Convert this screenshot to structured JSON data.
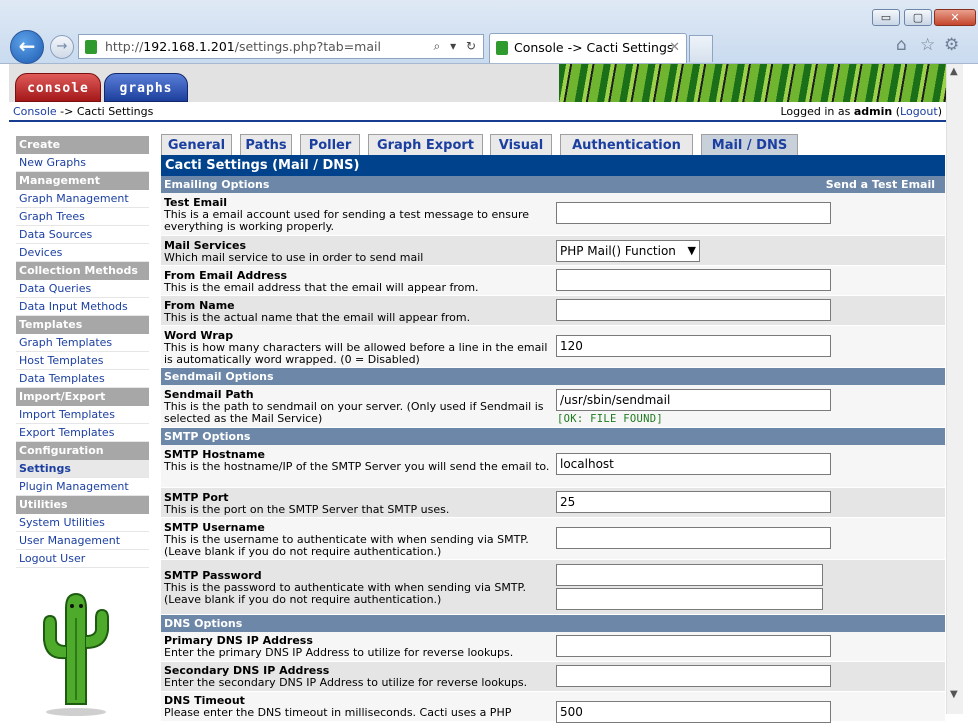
{
  "browser": {
    "url_prefix": "http://",
    "url_host": "192.168.1.201",
    "url_path": "/settings.php?tab=mail",
    "tab_title": "Console -> Cacti Settings",
    "back_glyph": "←",
    "forward_glyph": "→",
    "search_glyph": "⌕ ▾",
    "refresh_glyph": "↻",
    "tab_close_glyph": "✕",
    "min_glyph": "▭",
    "max_glyph": "▢",
    "close_glyph": "✕",
    "icons": [
      "home-icon",
      "favorites-star-icon",
      "tools-gear-icon"
    ]
  },
  "header": {
    "tab_console": "console",
    "tab_graphs": "graphs"
  },
  "breadcrumb": {
    "link": "Console",
    "sep": " -> ",
    "current": "Cacti Settings",
    "logged_in_prefix": "Logged in as ",
    "user": "admin",
    "logout_open": " (",
    "logout_label": "Logout",
    "logout_close": ")"
  },
  "sidebar": {
    "groups": [
      {
        "title": "Create",
        "items": [
          "New Graphs"
        ]
      },
      {
        "title": "Management",
        "items": [
          "Graph Management",
          "Graph Trees",
          "Data Sources",
          "Devices"
        ]
      },
      {
        "title": "Collection Methods",
        "items": [
          "Data Queries",
          "Data Input Methods"
        ]
      },
      {
        "title": "Templates",
        "items": [
          "Graph Templates",
          "Host Templates",
          "Data Templates"
        ]
      },
      {
        "title": "Import/Export",
        "items": [
          "Import Templates",
          "Export Templates"
        ]
      },
      {
        "title": "Configuration",
        "items": [
          "Settings",
          "Plugin Management"
        ]
      },
      {
        "title": "Utilities",
        "items": [
          "System Utilities",
          "User Management",
          "Logout User"
        ]
      }
    ],
    "active_item": "Settings"
  },
  "tabs": [
    "General",
    "Paths",
    "Poller",
    "Graph Export",
    "Visual",
    "Authentication",
    "Mail / DNS"
  ],
  "active_tab": "Mail / DNS",
  "settings": {
    "title": "Cacti Settings (Mail / DNS)",
    "emailing_header": "Emailing Options",
    "send_test": "Send a Test Email",
    "test_email_label": "Test Email",
    "test_email_desc": "This is a email account used for sending a test message to ensure everything is working properly.",
    "test_email_value": "",
    "mail_services_label": "Mail Services",
    "mail_services_desc": "Which mail service to use in order to send mail",
    "mail_services_value": "PHP Mail() Function",
    "from_email_label": "From Email Address",
    "from_email_desc": "This is the email address that the email will appear from.",
    "from_email_value": "",
    "from_name_label": "From Name",
    "from_name_desc": "This is the actual name that the email will appear from.",
    "from_name_value": "",
    "word_wrap_label": "Word Wrap",
    "word_wrap_desc": "This is how many characters will be allowed before a line in the email is automatically word wrapped. (0 = Disabled)",
    "word_wrap_value": "120",
    "sendmail_header": "Sendmail Options",
    "sendmail_path_label": "Sendmail Path",
    "sendmail_path_desc": "This is the path to sendmail on your server. (Only used if Sendmail is selected as the Mail Service)",
    "sendmail_path_value": "/usr/sbin/sendmail",
    "sendmail_status": "[OK: FILE FOUND]",
    "smtp_header": "SMTP Options",
    "smtp_host_label": "SMTP Hostname",
    "smtp_host_desc": "This is the hostname/IP of the SMTP Server you will send the email to.",
    "smtp_host_value": "localhost",
    "smtp_port_label": "SMTP Port",
    "smtp_port_desc": "This is the port on the SMTP Server that SMTP uses.",
    "smtp_port_value": "25",
    "smtp_user_label": "SMTP Username",
    "smtp_user_desc": "This is the username to authenticate with when sending via SMTP. (Leave blank if you do not require authentication.)",
    "smtp_user_value": "",
    "smtp_pass_label": "SMTP Password",
    "smtp_pass_desc": "This is the password to authenticate with when sending via SMTP. (Leave blank if you do not require authentication.)",
    "smtp_pass_value": "",
    "smtp_pass_confirm_value": "",
    "dns_header": "DNS Options",
    "dns1_label": "Primary DNS IP Address",
    "dns1_desc": "Enter the primary DNS IP Address to utilize for reverse lookups.",
    "dns1_value": "",
    "dns2_label": "Secondary DNS IP Address",
    "dns2_desc": "Enter the secondary DNS IP Address to utilize for reverse lookups.",
    "dns2_value": "",
    "dns_timeout_label": "DNS Timeout",
    "dns_timeout_desc": "Please enter the DNS timeout in milliseconds. Cacti uses a PHP",
    "dns_timeout_value": "500"
  },
  "colors": {
    "title_bar": "#00438c",
    "section_bar": "#6d87a8",
    "link": "#1b3fa0",
    "ok_text": "#1d7a1d"
  }
}
